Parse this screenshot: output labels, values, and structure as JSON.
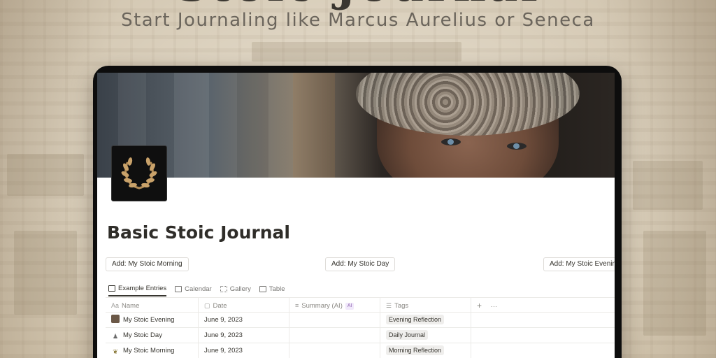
{
  "hero": {
    "title": "Stoic Journal",
    "subtitle": "Start Journaling like Marcus Aurelius or Seneca"
  },
  "page": {
    "title": "Basic Stoic Journal",
    "icon": "laurel-wreath-icon"
  },
  "buttons": {
    "morning": "Add: My Stoic Morning",
    "day": "Add: My Stoic Day",
    "evening": "Add: My Stoic Evening"
  },
  "views": [
    {
      "label": "Example Entries",
      "icon": "table-icon",
      "active": true
    },
    {
      "label": "Calendar",
      "icon": "calendar-icon"
    },
    {
      "label": "Gallery",
      "icon": "gallery-icon"
    },
    {
      "label": "Table",
      "icon": "table-icon"
    }
  ],
  "table": {
    "columns": {
      "name": "Name",
      "date": "Date",
      "summary": "Summary (AI)",
      "summary_badge": "AI",
      "tags": "Tags",
      "add": "+",
      "more": "···"
    },
    "rows": [
      {
        "icon": "portrait-icon",
        "name": "My Stoic Evening",
        "date": "June 9, 2023",
        "tag": "Evening Reflection"
      },
      {
        "icon": "statue-icon",
        "name": "My Stoic Day",
        "date": "June 9, 2023",
        "tag": "Daily Journal"
      },
      {
        "icon": "laurel-icon",
        "name": "My Stoic Morning",
        "date": "June 9, 2023",
        "tag": "Morning Reflection"
      }
    ]
  },
  "colors": {
    "background": "#d8cdb9",
    "text": "#37352f",
    "tag_bg": "#efeeec",
    "ai_badge": "#9065b0"
  }
}
